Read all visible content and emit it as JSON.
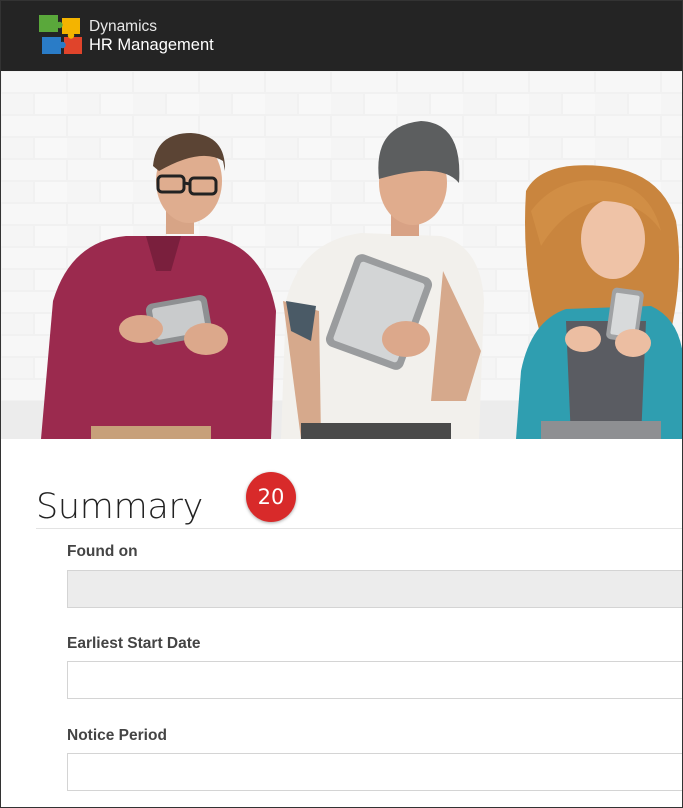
{
  "header": {
    "brand_line1": "Dynamics",
    "brand_line2": "HR Management",
    "logo_icon": "dynamics-puzzle-logo-icon",
    "logo_colors": [
      "#5aa83b",
      "#f4b400",
      "#2a7cc7",
      "#e0442b"
    ],
    "background": "#242424"
  },
  "hero": {
    "image": "three-people-with-tablets-against-white-brick-wall"
  },
  "summary": {
    "title": "Summary",
    "badge_number": "20",
    "badge_color": "#d82a2a",
    "fields": [
      {
        "label": "Found on",
        "value": "",
        "disabled": true
      },
      {
        "label": "Earliest Start Date",
        "value": ""
      },
      {
        "label": "Notice Period",
        "value": ""
      }
    ]
  }
}
